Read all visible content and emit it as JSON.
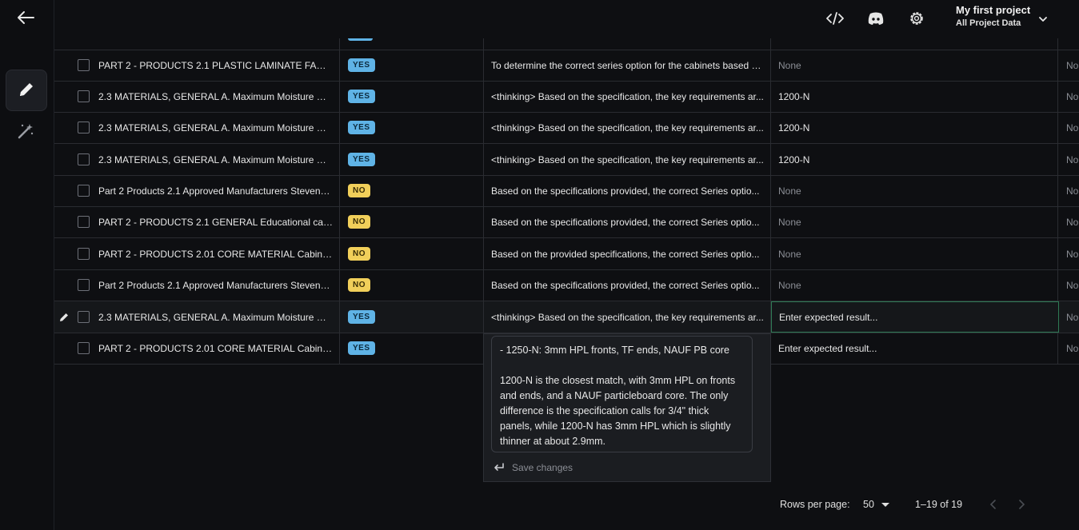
{
  "header": {
    "project_name": "My first project",
    "project_scope": "All Project Data"
  },
  "icons": {
    "back": "back-arrow-icon",
    "edit": "pencil-icon",
    "wand": "magic-wand-icon",
    "code": "code-icon",
    "discord": "discord-icon",
    "settings": "gear-icon"
  },
  "rows": [
    {
      "input": "PART 2 - PRODUCTS 2.1 PLASTIC LAMINATE FACE...",
      "badge": "YES",
      "output": "To determine the correct series option for the cabinets based o...",
      "expected": "None",
      "extra": "No"
    },
    {
      "input": "2.3 MATERIALS, GENERAL A. Maximum Moisture Co...",
      "badge": "YES",
      "output": "<thinking> Based on the specification, the key requirements ar...",
      "expected": "1200-N",
      "extra": "No"
    },
    {
      "input": "2.3 MATERIALS, GENERAL A. Maximum Moisture Co...",
      "badge": "YES",
      "output": "<thinking> Based on the specification, the key requirements ar...",
      "expected": "1200-N",
      "extra": "No"
    },
    {
      "input": "2.3 MATERIALS, GENERAL A. Maximum Moisture Co...",
      "badge": "YES",
      "output": "<thinking> Based on the specification, the key requirements ar...",
      "expected": "1200-N",
      "extra": "No"
    },
    {
      "input": "Part 2 Products 2.1 Approved Manufacturers Stevens...",
      "badge": "NO",
      "output": "Based on the specifications provided, the correct Series optio...",
      "expected": "None",
      "extra": "No"
    },
    {
      "input": "PART 2 - PRODUCTS 2.1 GENERAL Educational cas...",
      "badge": "NO",
      "output": "Based on the specifications provided, the correct Series optio...",
      "expected": "None",
      "extra": "No"
    },
    {
      "input": "PART 2 - PRODUCTS 2.01 CORE MATERIAL Cabinet...",
      "badge": "NO",
      "output": "Based on the provided specifications, the correct Series optio...",
      "expected": "None",
      "extra": "No"
    },
    {
      "input": "Part 2 Products 2.1 Approved Manufacturers Stevens...",
      "badge": "NO",
      "output": "Based on the specifications provided, the correct Series optio...",
      "expected": "None",
      "extra": "No"
    },
    {
      "input": "2.3 MATERIALS, GENERAL A. Maximum Moisture Co...",
      "badge": "YES",
      "output": "<thinking> Based on the specification, the key requirements ar...",
      "expected_placeholder": "Enter expected result...",
      "extra": "No"
    },
    {
      "input": "PART 2 - PRODUCTS 2.01 CORE MATERIAL Cabinet...",
      "badge": "YES",
      "output": "",
      "expected_placeholder": "Enter expected result...",
      "extra": "No"
    }
  ],
  "popover": {
    "line1": "- 1250-N: 3mm HPL fronts, TF ends, NAUF PB core",
    "line2": "1200-N is the closest match, with 3mm HPL on fronts and ends, and a NAUF particleboard core. The only difference is the specification calls for 3/4\" thick panels, while 1200-N has 3mm HPL which is slightly thinner at about 2.9mm.",
    "save_label": "Save changes"
  },
  "footer": {
    "rows_per_page_label": "Rows per page:",
    "rows_per_page_value": "50",
    "range": "1–19 of 19"
  }
}
